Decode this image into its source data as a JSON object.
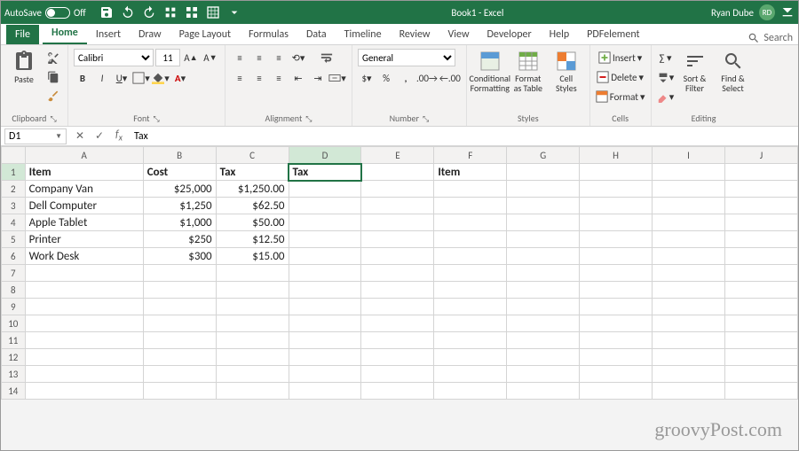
{
  "titlebar": {
    "autosave": "AutoSave",
    "autosave_state": "Off",
    "title": "Book1  -  Excel",
    "user": "Ryan Dube",
    "initials": "RD"
  },
  "tabs": {
    "file": "File",
    "items": [
      "Home",
      "Insert",
      "Draw",
      "Page Layout",
      "Formulas",
      "Data",
      "Timeline",
      "Review",
      "View",
      "Developer",
      "Help",
      "PDFelement"
    ],
    "active": "Home",
    "search": "Search"
  },
  "ribbon": {
    "clipboard": {
      "paste": "Paste",
      "label": "Clipboard"
    },
    "font": {
      "name": "Calibri",
      "size": "11",
      "label": "Font"
    },
    "alignment": {
      "wrap": "",
      "merge": "",
      "label": "Alignment"
    },
    "number": {
      "format": "General",
      "label": "Number"
    },
    "styles": {
      "cond": "Conditional Formatting",
      "fmttab": "Format as Table",
      "cell": "Cell Styles",
      "label": "Styles"
    },
    "cells": {
      "insert": "Insert",
      "delete": "Delete",
      "format": "Format",
      "label": "Cells"
    },
    "editing": {
      "sort": "Sort & Filter",
      "find": "Find & Select",
      "label": "Editing"
    }
  },
  "fbar": {
    "name": "D1",
    "formula": "Tax"
  },
  "grid": {
    "cols": [
      "A",
      "B",
      "C",
      "D",
      "E",
      "F",
      "G",
      "H",
      "I",
      "J"
    ],
    "rows": 14,
    "selected": {
      "row": 1,
      "col": "D"
    },
    "data": {
      "1": {
        "A": {
          "v": "Item",
          "b": true
        },
        "B": {
          "v": "Cost",
          "b": true
        },
        "C": {
          "v": "Tax",
          "b": true
        },
        "D": {
          "v": "Tax",
          "b": true
        },
        "F": {
          "v": "Item",
          "b": true
        }
      },
      "2": {
        "A": {
          "v": "Company Van"
        },
        "B": {
          "v": "$25,000",
          "n": true
        },
        "C": {
          "v": "$1,250.00",
          "n": true
        }
      },
      "3": {
        "A": {
          "v": "Dell Computer"
        },
        "B": {
          "v": "$1,250",
          "n": true
        },
        "C": {
          "v": "$62.50",
          "n": true
        }
      },
      "4": {
        "A": {
          "v": "Apple Tablet"
        },
        "B": {
          "v": "$1,000",
          "n": true
        },
        "C": {
          "v": "$50.00",
          "n": true
        }
      },
      "5": {
        "A": {
          "v": "Printer"
        },
        "B": {
          "v": "$250",
          "n": true
        },
        "C": {
          "v": "$12.50",
          "n": true
        }
      },
      "6": {
        "A": {
          "v": "Work Desk"
        },
        "B": {
          "v": "$300",
          "n": true
        },
        "C": {
          "v": "$15.00",
          "n": true
        }
      }
    }
  },
  "watermark": "groovyPost.com"
}
